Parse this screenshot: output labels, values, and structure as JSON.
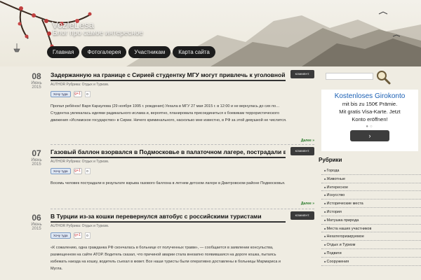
{
  "site": {
    "title": "VozleLesa",
    "description": "Блог про самое интересное"
  },
  "nav": [
    "Главная",
    "Фотогалерея",
    "Участникам",
    "Карта сайта"
  ],
  "posts": [
    {
      "day": "08",
      "month": "Июнь",
      "year": "2015",
      "title": "Задержанную на границе с Сирией студентку МГУ могут привлечь к уголовной ответстве",
      "comment_label": "КОММЕНТ.",
      "meta": "AUTHOR Рубрика: Отдых и Туризм.",
      "share_label": "Хочу туда",
      "gplus_label": "g+1",
      "gplus_count": "0",
      "text": "Пропал ребёнок! Варя Караулова (29 ноября 1995 г. рождения) Уехала в МГУ 27 мая 2015 г. в 12:00 и не вернулась до сих по… Студентка увлекалась идеями радикального ислама и, вероятно, планировала присоединиться к боевикам террористического движения «Исламское государство» в Сирии. Ничего криминального, насколько мне известно, в РФ за этой девушкой не числится.",
      "more_label": "Далее »"
    },
    {
      "day": "07",
      "month": "Июнь",
      "year": "2015",
      "title": "Газовый баллон взорвался в Подмосковье в палаточном лагере, пострадали восемь дете",
      "comment_label": "КОММЕНТ.",
      "meta": "AUTHOR Рубрика: Отдых и Туризм.",
      "share_label": "Хочу туда",
      "gplus_label": "g+1",
      "gplus_count": "0",
      "text": "Восемь человек пострадали в результате взрыва газового баллона в летнем детском лагере в Дмитровском районе Подмосковья.",
      "more_label": "Далее »"
    },
    {
      "day": "06",
      "month": "Июнь",
      "year": "2015",
      "title": "В Турции из-за кошки перевернулся автобус с российскими туристами",
      "comment_label": "КОММЕНТ.",
      "meta": "AUTHOR Рубрика: Отдых и Туризм.",
      "share_label": "Хочу туда",
      "gplus_label": "g+1",
      "gplus_count": "0",
      "text": "«К сожалению, одна гражданка РФ скончалась в больнице от полученных травм», — сообщается в заявлении консульства, размещенном на сайте АТОР. Водитель сказал, что причиной аварии стала внезапно появившаяся на дороге кошка, пытаясь избежать наезда на кошку, водитель съехал в кювет. Все наши туристы были оперативно доставлены в больницы Мармариса и Мугла."
    }
  ],
  "sidebar": {
    "ad": {
      "title": "Kostenloses Girokonto",
      "line1": "mit bis zu 150€ Prämie.",
      "line2": "Mit gratis Visa-Karte. Jetzt",
      "line3": "Konto eröffnen!",
      "button": "›"
    },
    "rubrics_title": "Рубрики",
    "rubrics": [
      "Города",
      "Животные",
      "Интересное",
      "Искусство",
      "Исторические места",
      "История",
      "Матушка природа",
      "Места наших участников",
      "Нехатегоризируемое",
      "Отдых и Туризм",
      "Подвиги",
      "Сооружения"
    ]
  },
  "colors": {
    "background": "#efece2",
    "nav_bg": "#1c1c1c",
    "link_green": "#2a7a2a",
    "ad_blue": "#1a5fb4"
  }
}
